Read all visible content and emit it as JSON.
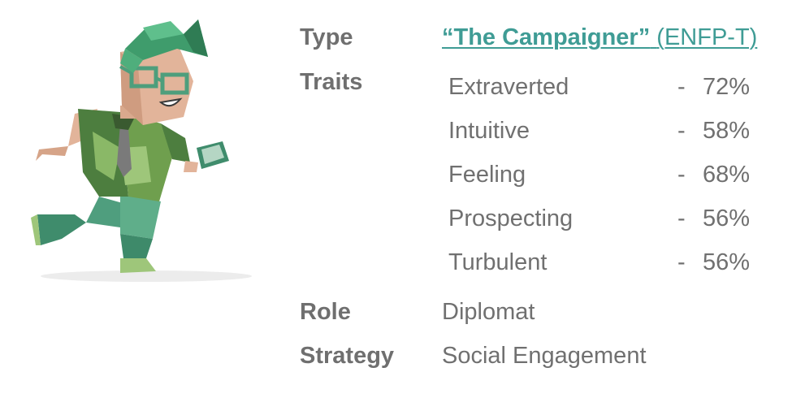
{
  "profile": {
    "type_label": "Type",
    "type_name": "“The Campaigner”",
    "type_code": "(ENFP-T)",
    "traits_label": "Traits",
    "traits": [
      {
        "name": "Extraverted",
        "dash": "-",
        "percent": "72%"
      },
      {
        "name": "Intuitive",
        "dash": "-",
        "percent": "58%"
      },
      {
        "name": "Feeling",
        "dash": "-",
        "percent": "68%"
      },
      {
        "name": "Prospecting",
        "dash": "-",
        "percent": "56%"
      },
      {
        "name": "Turbulent",
        "dash": "-",
        "percent": "56%"
      }
    ],
    "role_label": "Role",
    "role_value": "Diplomat",
    "strategy_label": "Strategy",
    "strategy_value": "Social Engagement"
  },
  "colors": {
    "label_text": "#6f6f6f",
    "value_text": "#707070",
    "link_accent": "#3f9c95",
    "character_dark_green": "#3e6e3a",
    "character_light_green": "#9ec67a",
    "character_teal": "#4e9e7c",
    "character_skin": "#e2b49a"
  },
  "illustration": {
    "icon": "campaigner-character-icon"
  }
}
